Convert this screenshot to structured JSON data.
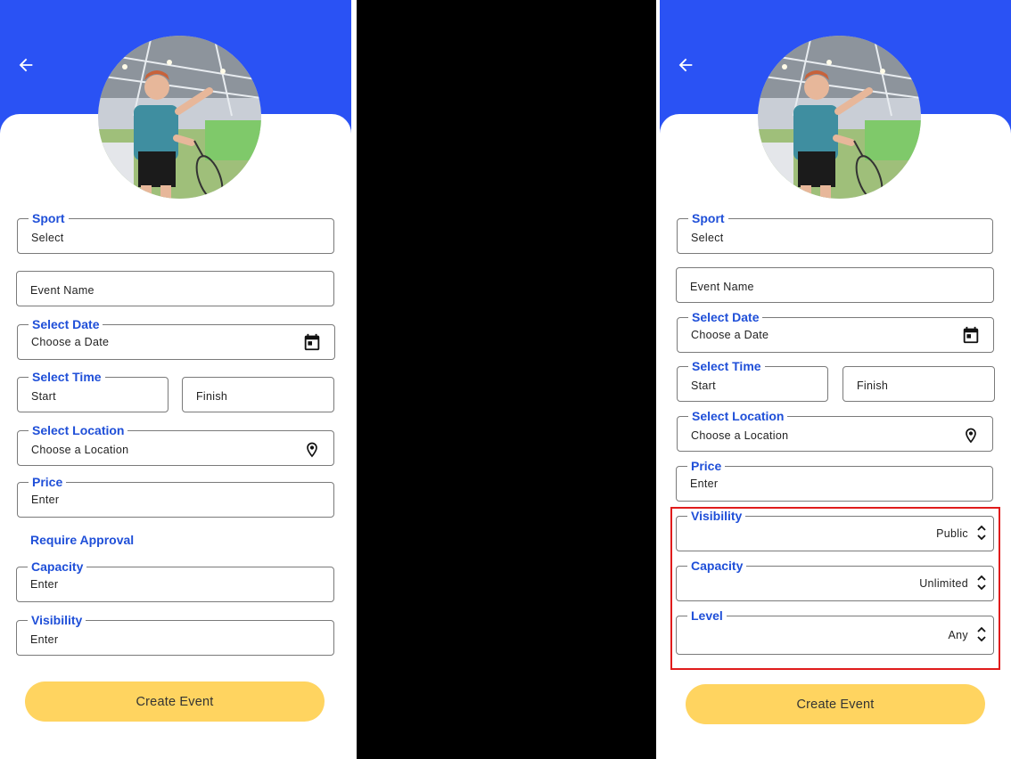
{
  "icons": {
    "back": "arrow-left-icon",
    "calendar": "calendar-icon",
    "location": "map-pin-icon",
    "stepper": "chevron-up-down-icon"
  },
  "colors": {
    "header": "#2a52f4",
    "accent_label": "#1f4fd8",
    "button": "#ffd460",
    "highlight": "#e01b1b"
  },
  "left": {
    "sport": {
      "label": "Sport",
      "value": "Select"
    },
    "event_name": {
      "placeholder": "Event Name"
    },
    "date": {
      "label": "Select Date",
      "value": "Choose a Date"
    },
    "time": {
      "label": "Select Time",
      "start": "Start",
      "finish": "Finish"
    },
    "location": {
      "label": "Select Location",
      "value": "Choose a Location"
    },
    "price": {
      "label": "Price",
      "value": "Enter"
    },
    "require_approval": "Require Approval",
    "capacity": {
      "label": "Capacity",
      "value": "Enter"
    },
    "visibility": {
      "label": "Visibility",
      "value": "Enter"
    },
    "create_button": "Create Event"
  },
  "right": {
    "sport": {
      "label": "Sport",
      "value": "Select"
    },
    "event_name": {
      "placeholder": "Event Name"
    },
    "date": {
      "label": "Select Date",
      "value": "Choose a Date"
    },
    "time": {
      "label": "Select Time",
      "start": "Start",
      "finish": "Finish"
    },
    "location": {
      "label": "Select Location",
      "value": "Choose a Location"
    },
    "price": {
      "label": "Price",
      "value": "Enter"
    },
    "visibility": {
      "label": "Visibility",
      "value": "Public"
    },
    "capacity": {
      "label": "Capacity",
      "value": "Unlimited"
    },
    "level": {
      "label": "Level",
      "value": "Any"
    },
    "create_button": "Create Event"
  }
}
